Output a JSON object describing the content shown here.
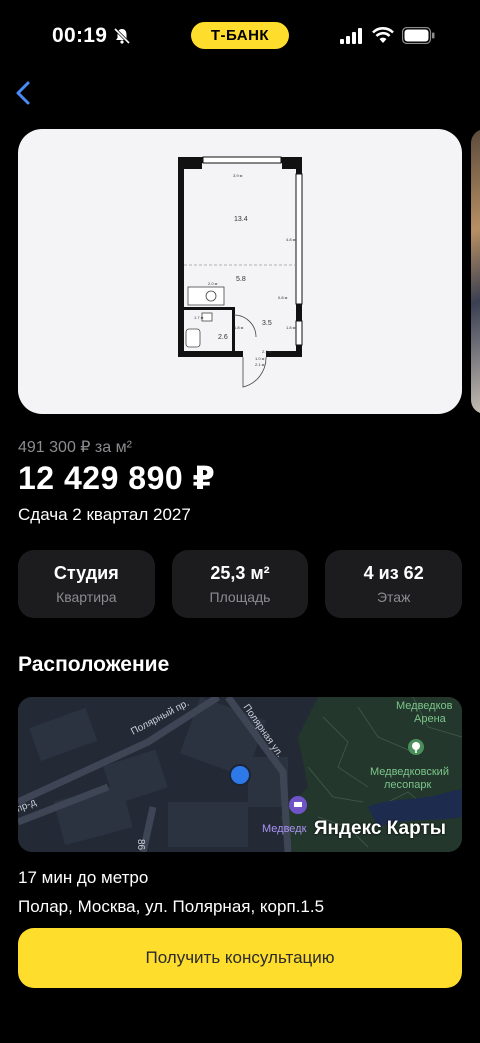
{
  "status_bar": {
    "time": "00:19",
    "bank_label": "Т-БАНК"
  },
  "listing": {
    "floorplan": {
      "room_main": "13.4",
      "room_hall": "5.8",
      "room_kitchen": "3.5",
      "room_bath": "2.6",
      "dim_top": "3.9 м",
      "dim_right": "4.8 м",
      "dim_mid": "2.0 м",
      "dim_mid_right": "0.8 м",
      "dim_bath_w": "1.7 м",
      "dim_bath_h": "1.8 м",
      "dim_door": "1.0 м",
      "dim_bottom_1": "2.1 м",
      "dim_bottom_2": "2.1 м",
      "dim_right_low": "1.8 м"
    },
    "price_per_m2": "491 300 ₽ за м²",
    "price": "12 429 890 ₽",
    "delivery": "Сдача 2 квартал 2027",
    "stats": [
      {
        "value": "Студия",
        "label": "Квартира"
      },
      {
        "value": "25,3 м²",
        "label": "Площадь"
      },
      {
        "value": "4 из 62",
        "label": "Этаж"
      }
    ]
  },
  "location": {
    "title": "Расположение",
    "map": {
      "attribution": "Яндекс Карты",
      "labels": {
        "street_1": "Полярный пр.",
        "street_2": "Полярная ул.",
        "street_3": "пр-д",
        "number": "86",
        "poi": "Медведк",
        "arena": "Медведков Арена",
        "park": "Медведковский лесопарк"
      }
    },
    "metro_time": "17 мин до метро",
    "address": "Полар, Москва, ул. Полярная, корп.1.5"
  },
  "cta": {
    "label": "Получить консультацию"
  },
  "colors": {
    "accent": "#ffdd2d",
    "card": "#1c1c1e",
    "muted": "#8c8c91",
    "back": "#4a8cf7"
  },
  "icons": [
    "back-chevron-icon",
    "bell-off-icon",
    "signal-icon",
    "wifi-icon",
    "battery-icon",
    "map-pin-icon",
    "hotel-icon",
    "tree-icon"
  ]
}
